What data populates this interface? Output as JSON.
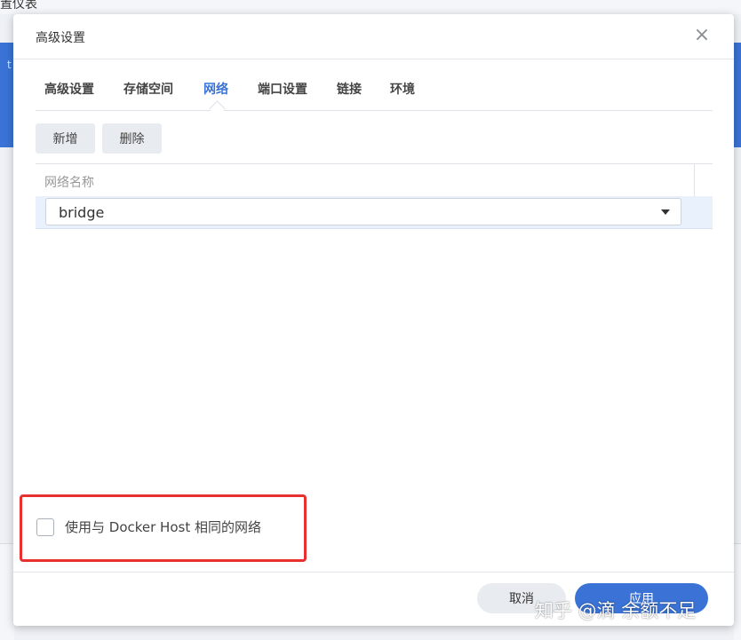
{
  "background": {
    "top_text": "置仪表",
    "left_text": "t"
  },
  "dialog": {
    "title": "高级设置",
    "close_glyph": "×"
  },
  "tabs": [
    {
      "label": "高级设置",
      "active": false
    },
    {
      "label": "存储空间",
      "active": false
    },
    {
      "label": "网络",
      "active": true
    },
    {
      "label": "端口设置",
      "active": false
    },
    {
      "label": "链接",
      "active": false
    },
    {
      "label": "环境",
      "active": false
    }
  ],
  "toolbar": {
    "add_label": "新增",
    "delete_label": "删除"
  },
  "table": {
    "column_header": "网络名称",
    "rows": [
      {
        "network": "bridge"
      }
    ]
  },
  "host_network": {
    "label": "使用与 Docker Host 相同的网络",
    "checked": false
  },
  "footer": {
    "cancel_label": "取消",
    "apply_label": "应用"
  },
  "watermark": "知乎 @滴 余额不足",
  "colors": {
    "accent": "#3a73d5",
    "highlight_border": "#e8302e",
    "selected_row": "#e9f1fc"
  }
}
